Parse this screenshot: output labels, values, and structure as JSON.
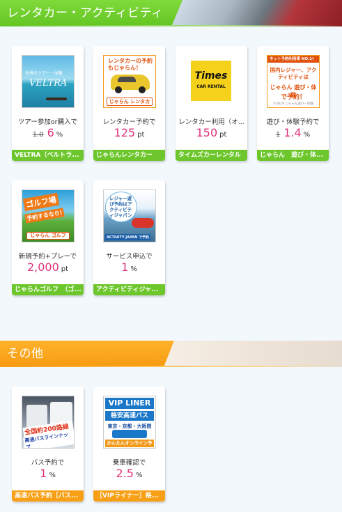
{
  "sections": {
    "rental": {
      "title": "レンタカー・アクティビティ"
    },
    "other": {
      "title": "その他"
    }
  },
  "cards": [
    {
      "thumb": {
        "line1": "世界のツアー・体験",
        "line2": "VELTRA"
      },
      "caption": "ツアー参加or購入で",
      "old_value": "1.0",
      "value": "6",
      "unit": "%",
      "store": "VELTRA（ベルトラ..."
    },
    {
      "thumb": {
        "line1": "レンタカーの予約もじゃらん！",
        "bar": "じゃらん レンタカー"
      },
      "caption": "レンタカー予約で",
      "old_value": "",
      "value": "125",
      "unit": "pt",
      "store": "じゃらんレンタカー"
    },
    {
      "thumb": {
        "line1": "Times",
        "line2": "CAR RENTAL"
      },
      "caption": "レンタカー利用（オ...",
      "old_value": "",
      "value": "150",
      "unit": "pt",
      "store": "タイムズカーレンタル"
    },
    {
      "thumb": {
        "top": "ネット予約利用率 NO.1!",
        "line1": "国内レジャー、アクティビティは",
        "line2": "じゃらん 遊び・体験",
        "line3": "で予約！",
        "line4": "©2019 じゃらん遊び・体験"
      },
      "caption": "遊び・体験予約で",
      "old_value": "1",
      "value": "1.4",
      "unit": "%",
      "store": "じゃらん　遊び・体..."
    },
    {
      "thumb": {
        "line1": "ゴルフ場",
        "line2": "予約するなら!",
        "bar": "じゃらん ゴルフ"
      },
      "caption": "新規予約+プレーで",
      "old_value": "",
      "value": "2,000",
      "unit": "pt",
      "store": "じゃらんゴルフ　（ゴ..."
    },
    {
      "thumb": {
        "line1": "レジャー遊び予約はアクティビティジャパン",
        "line2": "ACTIVITY JAPAN で予約"
      },
      "caption": "サービス申込で",
      "old_value": "",
      "value": "1",
      "unit": "%",
      "store": "アクティビティジャ..."
    },
    {
      "thumb": {
        "line1": "全国約200路線の",
        "line2": "高速バスラインナップ"
      },
      "caption": "バス予約で",
      "old_value": "",
      "value": "1",
      "unit": "%",
      "store": "高速バス予約［バス..."
    },
    {
      "thumb": {
        "line1": "VIP LINER",
        "line2": "格安高速バス",
        "line3": "東京・京都・大阪間",
        "line4": "かんたんオンライン予約"
      },
      "caption": "乗車確認で",
      "old_value": "",
      "value": "2.5",
      "unit": "%",
      "store": "［VIPライナー］格..."
    }
  ],
  "colors": {
    "green_accent": "#6dc72c",
    "orange_accent": "#f7a015",
    "value_pink": "#e0337a",
    "page_bg": "#f3f8fd"
  }
}
